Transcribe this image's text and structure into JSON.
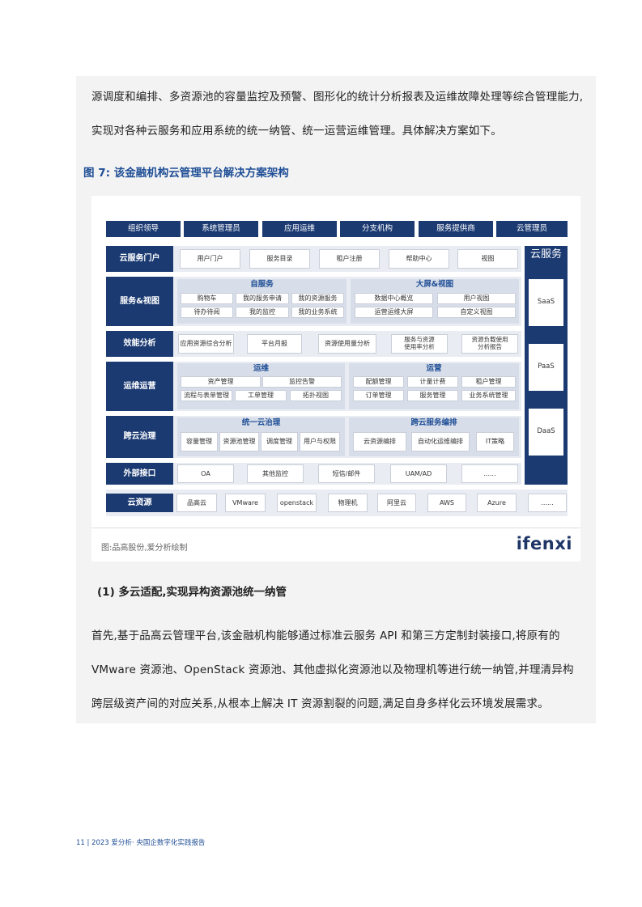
{
  "paragraphs": {
    "intro_line1": "源调度和编排、多资源池的容量监控及预警、图形化的统计分析报表及运维故障处理等综合管理能力,",
    "intro_line2": "实现对各种云服务和应用系统的统一纳管、统一运营运维管理。具体解决方案如下。"
  },
  "figure": {
    "caption": "图 7:  该金融机构云管理平台解决方案架构",
    "roles": [
      "组织领导",
      "系统管理员",
      "应用运维",
      "分支机构",
      "服务提供商",
      "云管理员"
    ],
    "rows": {
      "portal": {
        "label": "云服务门户",
        "items": [
          "用户门户",
          "服务目录",
          "租户注册",
          "帮助中心",
          "视图"
        ]
      },
      "service_view": {
        "label": "服务&视图",
        "self_service": {
          "title": "自服务",
          "items": [
            "购物车",
            "我的服务申请",
            "我的资源服务",
            "待办待阅",
            "我的监控",
            "我的业务系统"
          ]
        },
        "big_screen": {
          "title": "大屏&视图",
          "items": [
            "数据中心概览",
            "用户视图",
            "运营运维大屏",
            "自定义视图"
          ]
        }
      },
      "efficiency": {
        "label": "效能分析",
        "items": [
          "应用资源综合分析",
          "平台月报",
          "资源使用量分析",
          "服务与资源\n使用率分析",
          "资源负载使用\n分析报告"
        ]
      },
      "ops": {
        "label": "运维运营",
        "om": {
          "title": "运维",
          "items": [
            "资产管理",
            "监控告警",
            "流程与表单管理",
            "工单管理",
            "拓扑视图"
          ]
        },
        "operation": {
          "title": "运营",
          "items": [
            "配额管理",
            "计量计费",
            "租户管理",
            "订单管理",
            "服务管理",
            "业务系统管理"
          ]
        }
      },
      "governance": {
        "label": "跨云治理",
        "unified": {
          "title": "统一云治理",
          "items": [
            "容量管理",
            "资源池管理",
            "调度管理",
            "用户与权限"
          ]
        },
        "orchestration": {
          "title": "跨云服务编排",
          "items": [
            "云资源编排",
            "自动化运维编排",
            "IT策略"
          ]
        }
      },
      "external": {
        "label": "外部接口",
        "items": [
          "OA",
          "其他监控",
          "短信/邮件",
          "UAM/AD",
          "......"
        ]
      },
      "resources": {
        "label": "云资源",
        "items": [
          "品高云",
          "VMware",
          "openstack",
          "物理机",
          "阿里云",
          "AWS",
          "Azure",
          "......"
        ]
      }
    },
    "cloud_service": {
      "title": "云服务",
      "items": [
        "SaaS",
        "PaaS",
        "DaaS"
      ]
    },
    "source": "图:品高股份,爱分析绘制",
    "logo": "ifenxi"
  },
  "section": {
    "title": "(1) 多云适配,实现异构资源池统一纳管"
  },
  "body": {
    "line1": "首先,基于品高云管理平台,该金融机构能够通过标准云服务 API 和第三方定制封装接口,将原有的",
    "line2": "VMware 资源池、OpenStack 资源池、其他虚拟化资源池以及物理机等进行统一纳管,并理清异构",
    "line3": "跨层级资产间的对应关系,从根本上解决 IT 资源割裂的问题,满足自身多样化云环境发展需求。"
  },
  "footer": {
    "text": "11  |  2023 爱分析· 央国企数字化实践报告"
  }
}
